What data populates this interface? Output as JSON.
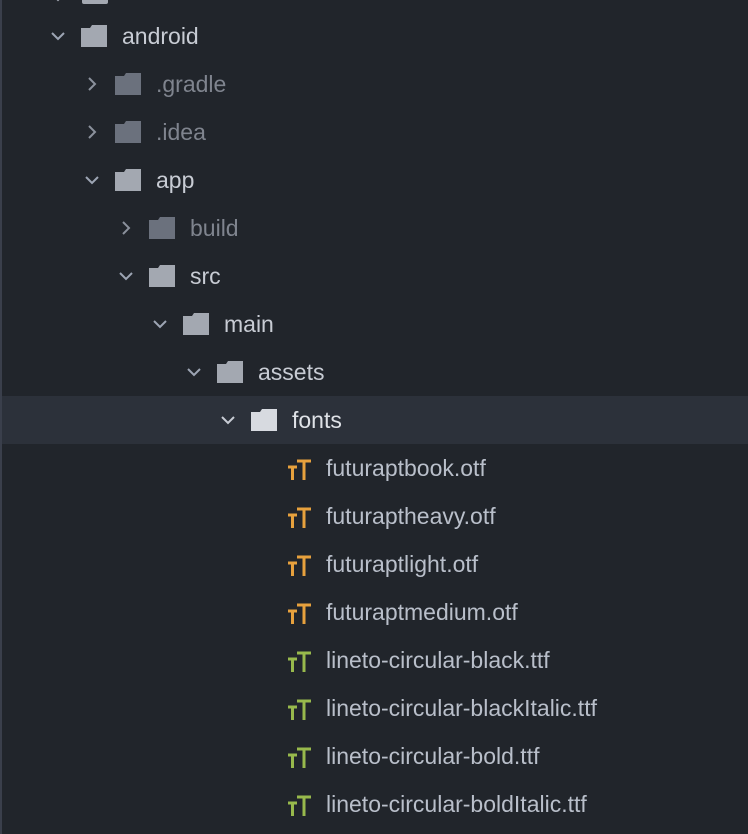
{
  "colors": {
    "background": "#21252b",
    "selected_row": "#2c313a",
    "folder_open": "#a3a8b1",
    "folder_dim": "#6b717d",
    "otf_icon": "#e7a13d",
    "ttf_icon": "#98b94c"
  },
  "tree": {
    "android": {
      "label": "android",
      "icon": "folder-icon",
      "expanded": true
    },
    "gradle": {
      "label": ".gradle",
      "icon": "folder-icon",
      "expanded": false
    },
    "idea": {
      "label": ".idea",
      "icon": "folder-icon",
      "expanded": false
    },
    "app": {
      "label": "app",
      "icon": "folder-icon",
      "expanded": true
    },
    "build": {
      "label": "build",
      "icon": "folder-icon",
      "expanded": false
    },
    "src": {
      "label": "src",
      "icon": "folder-icon",
      "expanded": true
    },
    "main": {
      "label": "main",
      "icon": "folder-icon",
      "expanded": true
    },
    "assets": {
      "label": "assets",
      "icon": "folder-icon",
      "expanded": true
    },
    "fonts": {
      "label": "fonts",
      "icon": "folder-icon",
      "expanded": true,
      "selected": true
    },
    "files": [
      {
        "label": "futuraptbook.otf",
        "icon": "font-file-icon",
        "type": "otf"
      },
      {
        "label": "futuraptheavy.otf",
        "icon": "font-file-icon",
        "type": "otf"
      },
      {
        "label": "futuraptlight.otf",
        "icon": "font-file-icon",
        "type": "otf"
      },
      {
        "label": "futuraptmedium.otf",
        "icon": "font-file-icon",
        "type": "otf"
      },
      {
        "label": "lineto-circular-black.ttf",
        "icon": "font-file-icon",
        "type": "ttf"
      },
      {
        "label": "lineto-circular-blackItalic.ttf",
        "icon": "font-file-icon",
        "type": "ttf"
      },
      {
        "label": "lineto-circular-bold.ttf",
        "icon": "font-file-icon",
        "type": "ttf"
      },
      {
        "label": "lineto-circular-boldItalic.ttf",
        "icon": "font-file-icon",
        "type": "ttf"
      }
    ]
  }
}
